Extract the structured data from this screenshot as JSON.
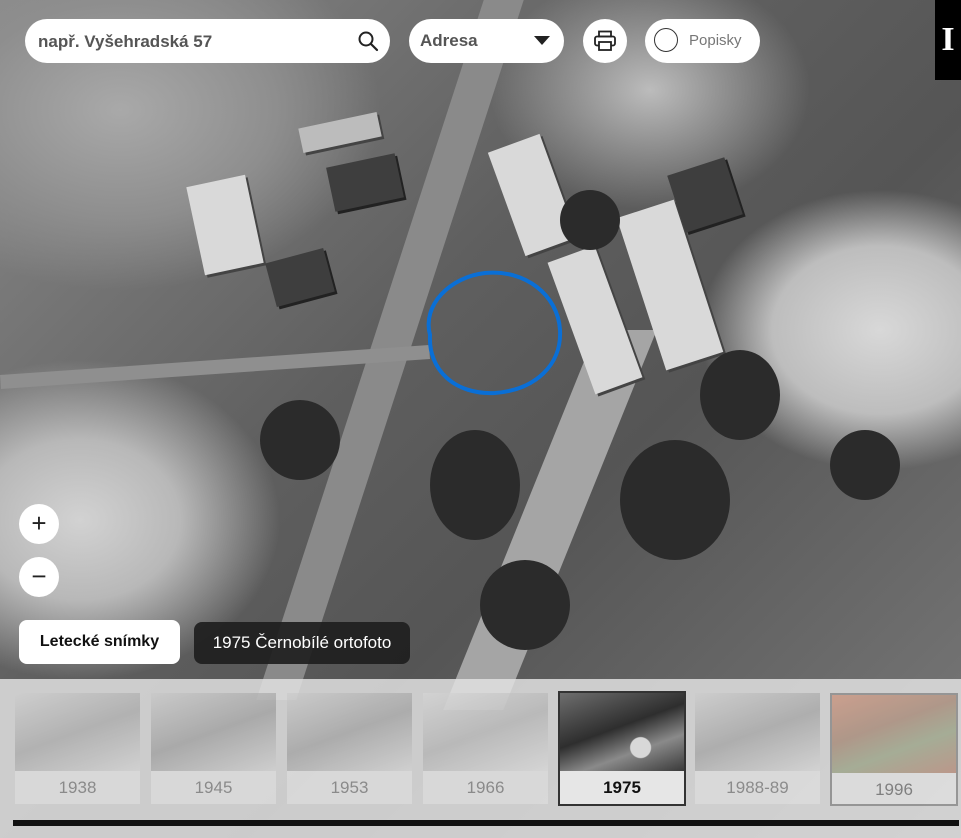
{
  "search": {
    "placeholder": "např. Vyšehradská 57"
  },
  "search_type": {
    "selected": "Adresa"
  },
  "labels_toggle": {
    "label": "Popisky"
  },
  "logo": {
    "text": "I"
  },
  "zoom": {
    "in_label": "+",
    "out_label": "−"
  },
  "layers": {
    "button_label": "Letecké snímky",
    "current_layer": "1975 Černobílé ortofoto"
  },
  "timeline": {
    "items": [
      {
        "year": "1938"
      },
      {
        "year": "1945"
      },
      {
        "year": "1953"
      },
      {
        "year": "1966"
      },
      {
        "year": "1975"
      },
      {
        "year": "1988-89"
      },
      {
        "year": "1996"
      }
    ],
    "active_year": "1975"
  },
  "colors": {
    "highlight": "#0a6fd6",
    "active_border": "#333333"
  },
  "icons": {
    "search": "search-icon",
    "dropdown": "chevron-down-icon",
    "print": "printer-icon",
    "labels": "radio-circle-icon"
  }
}
